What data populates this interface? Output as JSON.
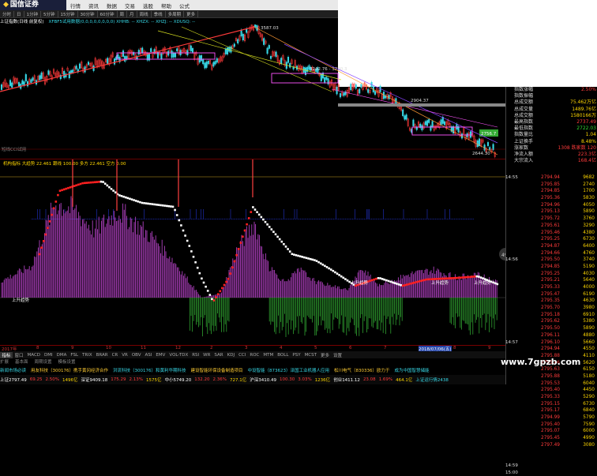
{
  "app": {
    "logo": "国信证券"
  },
  "menu": [
    "行情",
    "资讯",
    "数据",
    "交易",
    "选股",
    "帮助",
    "公式"
  ],
  "toolbar": [
    "分时",
    "日",
    "1分钟",
    "5分钟",
    "15分钟",
    "30分钟",
    "60分钟",
    "周",
    "月",
    "周线",
    "季线",
    "多周期",
    "更多"
  ],
  "infobar": {
    "title": "上证指数(日线 前复权)",
    "ma": "XFBF5试用数据(0,0,0,0,0,0,0,0) XHHB: -- XHZX: -- XHZJ: -- XDUSQ: --"
  },
  "main_labels": {
    "high": "3587.03",
    "mid": "3242.76 - 3220.3",
    "low2": "2904.37",
    "low": "2644.30",
    "side_label": "短线CCI试用",
    "right_levels": [
      "3100",
      "3000",
      "2900",
      "2800",
      "2700",
      "2600"
    ]
  },
  "indicator": {
    "header": "机构指标 大趋势 22.461 跟线 100.00 多方 22.461 空方 0.00",
    "labels": [
      "上升趋势",
      "上升趋势",
      "上升趋势",
      "上升趋势"
    ],
    "left_axis": [
      "100",
      "80",
      "60",
      "40",
      "20",
      "0",
      "-20"
    ],
    "mid_tag": "49"
  },
  "axis": {
    "labels": [
      "2017年",
      "8",
      "9",
      "10",
      "11",
      "12",
      "2",
      "3",
      "4",
      "5",
      "6",
      "7",
      "2018/07/06(五)",
      "8",
      "9"
    ]
  },
  "tabs": [
    "指标",
    "窗口",
    "MACD",
    "DMI",
    "DMA",
    "FSL",
    "TRIX",
    "BRAR",
    "CR",
    "VR",
    "OBV",
    "ASI",
    "EMV",
    "VOL-TDX",
    "RSI",
    "WR",
    "SAR",
    "KDJ",
    "CCI",
    "ROC",
    "MTM",
    "BOLL",
    "PSY",
    "MCST",
    "更多",
    "设置"
  ],
  "scroll_row": [
    "扩展",
    "基本面",
    "周期设置",
    "模板设置"
  ],
  "ticker": [
    "新闻市场必读",
    "用友科技（300176）携手黄冈经济合作",
    "洪流科技（300176）和黄利华期科技",
    "建设智能环保设备制造项目",
    "中设智能（873623）泽国工业机器人应用",
    "松川电气（830336）欧力于",
    "成为中国智慧储能"
  ],
  "status": {
    "sh": "上证2797.49",
    "sh_chg": "69.25",
    "sh_pct": "2.50%",
    "sh_amt": "1496亿",
    "sz": "深证9409.18",
    "sz_chg": "175.29",
    "sz_pct": "2.13%",
    "sz_amt": "1575亿",
    "cyb": "中小5749.20",
    "cyb_chg": "132.20",
    "cyb_pct": "2.36%",
    "cyb_amt": "727.1亿",
    "hs": "沪深3410.49",
    "hs_chg": "100.30",
    "hs_pct": "3.03%",
    "hs_amt": "1236亿",
    "gy": "创业1411.12",
    "gy_chg": "23.08",
    "gy_pct": "1.69%",
    "gy_amt": "464.1亿",
    "tail": "上证运行情2438"
  },
  "panel": {
    "rows": [
      {
        "label": "指数涨幅",
        "value": "2.50%",
        "color": "#ff3b3b"
      },
      {
        "label": "指数振幅",
        "value": "",
        "color": "#ff3b3b"
      },
      {
        "label": "总成交额",
        "value": "75.462万亿",
        "color": "#ffd700"
      },
      {
        "label": "总成交量",
        "value": "1489.76亿",
        "color": "#ffd700"
      },
      {
        "label": "总成交额",
        "value": "1580166万",
        "color": "#ffd700"
      },
      {
        "label": "最高指数",
        "value": "2737.49",
        "color": "#ff3b3b"
      },
      {
        "label": "最低指数",
        "value": "2722.03",
        "color": "#31d931"
      },
      {
        "label": "指数量比",
        "value": "1.04",
        "color": "#ffd700"
      },
      {
        "label": "上证换手",
        "value": "8.48%",
        "color": "#ffd700"
      },
      {
        "label": "涨家数",
        "value": "1308  跌家数  120",
        "color": "#ff3b3b"
      },
      {
        "label": "净流入额",
        "value": "223.3亿",
        "color": "#ff3b3b"
      },
      {
        "label": "大宗流入",
        "value": "168.4亿",
        "color": "#ff3b3b"
      }
    ],
    "price_tag": "2756.7"
  },
  "scale_levels": [
    "14:55",
    "",
    "",
    "",
    "",
    "",
    "",
    "",
    "",
    "",
    "",
    "",
    "14:56",
    "",
    "",
    "",
    "",
    "",
    "",
    "",
    "",
    "",
    "",
    "",
    "14:57",
    "",
    "",
    "",
    "",
    "",
    "",
    "",
    "",
    "",
    "",
    "",
    "",
    "",
    "",
    "",
    "",
    "",
    "14:59",
    "15:00"
  ],
  "trades": [
    [
      "2794.94",
      "9682"
    ],
    [
      "2795.85",
      "2740"
    ],
    [
      "2794.85",
      "1700"
    ],
    [
      "2795.36",
      "5830"
    ],
    [
      "2794.96",
      "4050"
    ],
    [
      "2795.13",
      "5890"
    ],
    [
      "2795.72",
      "3760"
    ],
    [
      "2795.61",
      "3290"
    ],
    [
      "2795.46",
      "4380"
    ],
    [
      "2795.25",
      "6730"
    ],
    [
      "2794.87",
      "6400"
    ],
    [
      "2794.66",
      "4760"
    ],
    [
      "2795.50",
      "3740"
    ],
    [
      "2794.85",
      "5190"
    ],
    [
      "2795.25",
      "4030"
    ],
    [
      "2795.21",
      "5640"
    ],
    [
      "2795.33",
      "4000"
    ],
    [
      "2795.47",
      "6190"
    ],
    [
      "2795.35",
      "4630"
    ],
    [
      "2795.70",
      "3980"
    ],
    [
      "2795.18",
      "6910"
    ],
    [
      "2795.62",
      "5380"
    ],
    [
      "2795.50",
      "5890"
    ],
    [
      "2796.11",
      "4880"
    ],
    [
      "2796.10",
      "5660"
    ],
    [
      "2794.94",
      "4550"
    ],
    [
      "2795.88",
      "4110"
    ],
    [
      "2795.46",
      "5620"
    ],
    [
      "2795.63",
      "6150"
    ],
    [
      "2795.88",
      "5180"
    ],
    [
      "2795.53",
      "6040"
    ],
    [
      "2795.40",
      "4450"
    ],
    [
      "2795.33",
      "5290"
    ],
    [
      "2795.15",
      "6730"
    ],
    [
      "2795.17",
      "6840"
    ],
    [
      "2794.99",
      "5790"
    ],
    [
      "2795.40",
      "7590"
    ],
    [
      "2795.07",
      "6000"
    ],
    [
      "2795.45",
      "4990"
    ],
    [
      "2797.49",
      "3080"
    ]
  ],
  "watermark": "www.7gpzb.com"
}
